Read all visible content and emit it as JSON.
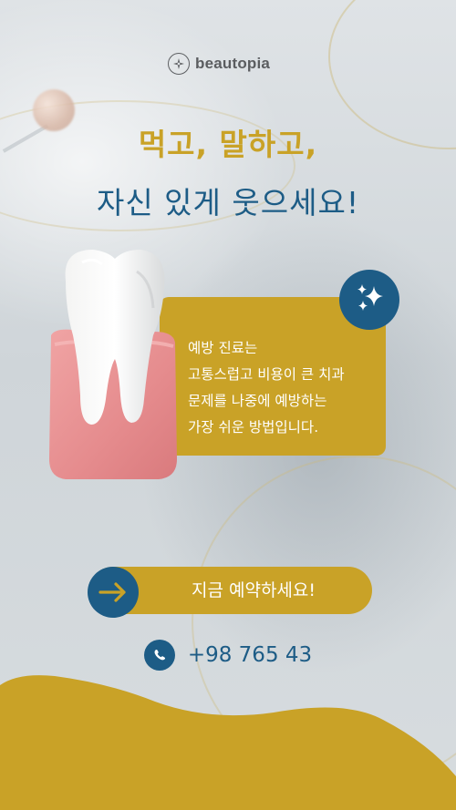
{
  "brand": {
    "name": "beautopia",
    "logo_icon": "compass-rose-icon"
  },
  "headline": {
    "line1": "먹고, 말하고,",
    "line2": "자신 있게 웃으세요!"
  },
  "info": {
    "lines": [
      "예방 진료는",
      "고통스럽고 비용이 큰 치과",
      "문제를 나중에 예방하는",
      "가장 쉬운 방법입니다."
    ],
    "badge_icon": "sparkle-icon"
  },
  "cta": {
    "label": "지금 예약하세요!",
    "icon": "arrow-right-icon"
  },
  "contact": {
    "phone": "+98 765 43",
    "icon": "whatsapp-icon"
  },
  "colors": {
    "gold": "#c9a227",
    "navy": "#1d5c86",
    "background": "#d9dee1",
    "logo_gray": "#5b5d60"
  }
}
